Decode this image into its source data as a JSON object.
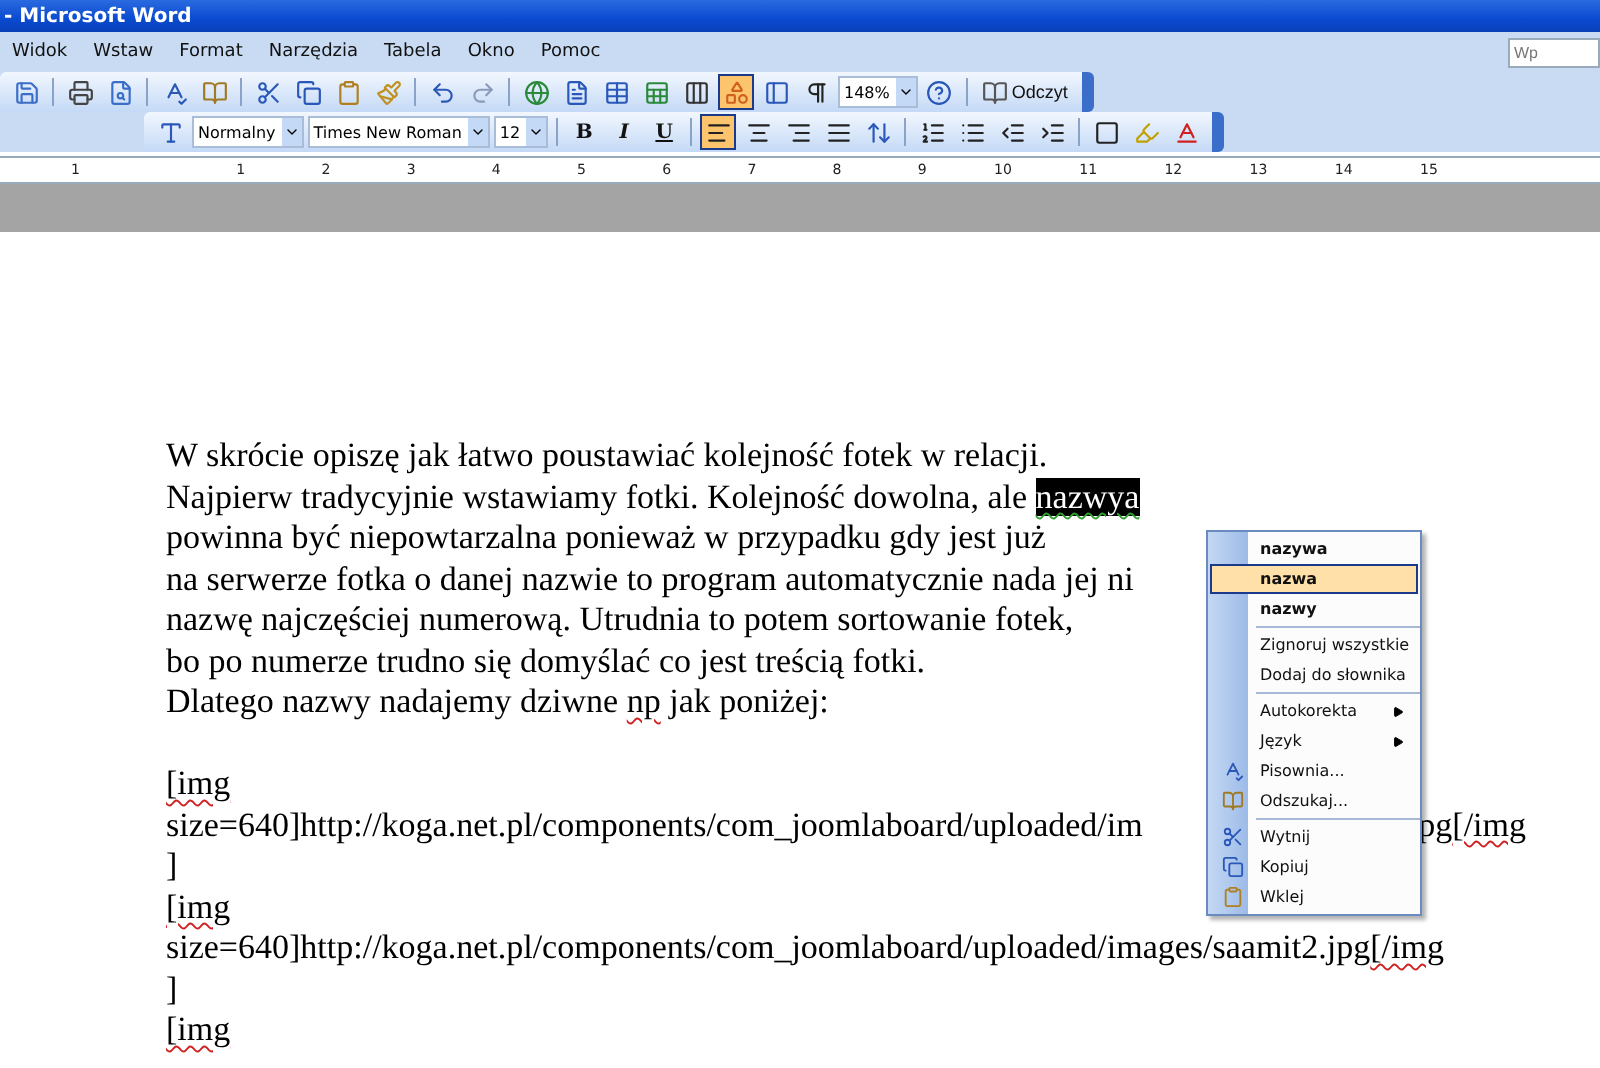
{
  "window": {
    "title": "- Microsoft Word"
  },
  "menu_bar": {
    "items": [
      {
        "label": "Widok"
      },
      {
        "label": "Wstaw"
      },
      {
        "label": "Format"
      },
      {
        "label": "Narzędzia"
      },
      {
        "label": "Tabela"
      },
      {
        "label": "Okno"
      },
      {
        "label": "Pomoc"
      }
    ],
    "help_search": {
      "placeholder": "Wp"
    }
  },
  "standard_toolbar": {
    "items": [
      {
        "kind": "icon",
        "on": false
      },
      {
        "kind": "sep"
      },
      {
        "kind": "icon",
        "on": false
      },
      {
        "kind": "icon",
        "on": false
      },
      {
        "kind": "sep"
      },
      {
        "kind": "icon",
        "on": false
      },
      {
        "kind": "icon",
        "on": false
      },
      {
        "kind": "sep"
      },
      {
        "kind": "icon",
        "on": false
      },
      {
        "kind": "icon",
        "on": false
      },
      {
        "kind": "icon",
        "on": false
      },
      {
        "kind": "icon",
        "on": false
      },
      {
        "kind": "sep"
      },
      {
        "kind": "icon",
        "on": false
      },
      {
        "kind": "icon",
        "on": false
      },
      {
        "kind": "sep"
      },
      {
        "kind": "icon",
        "on": false
      },
      {
        "kind": "icon",
        "on": false
      },
      {
        "kind": "icon",
        "on": false
      },
      {
        "kind": "icon",
        "on": false
      },
      {
        "kind": "icon",
        "on": false
      },
      {
        "kind": "icon",
        "on": true
      },
      {
        "kind": "icon",
        "on": false
      },
      {
        "kind": "icon",
        "on": false
      },
      {
        "kind": "combo",
        "value": "148%"
      },
      {
        "kind": "icon",
        "on": false
      },
      {
        "kind": "sep"
      },
      {
        "kind": "button",
        "label": "Odczyt"
      }
    ]
  },
  "formatting_toolbar": {
    "items": [
      {
        "kind": "icon",
        "on": false
      },
      {
        "kind": "combo",
        "value": "Normalny"
      },
      {
        "kind": "combo",
        "value": "Times New Roman"
      },
      {
        "kind": "combo",
        "value": "12"
      },
      {
        "kind": "sep"
      },
      {
        "kind": "text",
        "label": "B",
        "on": false
      },
      {
        "kind": "text",
        "label": "I",
        "on": false
      },
      {
        "kind": "text",
        "label": "U",
        "on": false
      },
      {
        "kind": "sep"
      },
      {
        "kind": "icon",
        "on": true
      },
      {
        "kind": "icon",
        "on": false
      },
      {
        "kind": "icon",
        "on": false
      },
      {
        "kind": "icon",
        "on": false
      },
      {
        "kind": "icon",
        "on": false
      },
      {
        "kind": "sep"
      },
      {
        "kind": "icon",
        "on": false
      },
      {
        "kind": "icon",
        "on": false
      },
      {
        "kind": "icon",
        "on": false
      },
      {
        "kind": "icon",
        "on": false
      },
      {
        "kind": "sep"
      },
      {
        "kind": "icon",
        "on": false
      },
      {
        "kind": "icon",
        "on": false
      },
      {
        "kind": "icon",
        "on": false
      }
    ]
  },
  "ruler": {
    "labels": [
      "1",
      "1",
      "2",
      "3",
      "4",
      "5",
      "6",
      "7",
      "8",
      "9",
      "10",
      "11",
      "12",
      "13",
      "14",
      "15"
    ]
  },
  "document": {
    "lines": [
      {
        "kind": "text",
        "parts": [
          {
            "text": "W skrócie opiszę jak łatwo poustawiać kolejność fotek w relacji.",
            "kind": "plain"
          }
        ]
      },
      {
        "kind": "text",
        "parts": [
          {
            "text": "Najpierw tradycyjnie wstawiamy fotki. Kolejność dowolna, ale ",
            "kind": "plain"
          },
          {
            "text": "nazwya",
            "kind": "selected"
          }
        ]
      },
      {
        "kind": "text",
        "parts": [
          {
            "text": "powinna być niepowtarzalna ponieważ w przypadku gdy jest już",
            "kind": "plain"
          }
        ]
      },
      {
        "kind": "text",
        "parts": [
          {
            "text": "na serwerze fotka o danej nazwie to program automatycznie nada jej ni",
            "kind": "plain"
          }
        ]
      },
      {
        "kind": "text",
        "parts": [
          {
            "text": "nazwę najczęściej numerową. Utrudnia to potem sortowanie fotek,",
            "kind": "plain"
          }
        ]
      },
      {
        "kind": "text",
        "parts": [
          {
            "text": "bo po numerze trudno się domyślać co jest treścią fotki.",
            "kind": "plain"
          }
        ]
      },
      {
        "kind": "text",
        "parts": [
          {
            "text": "Dlatego nazwy nadajemy dziwne ",
            "kind": "plain"
          },
          {
            "text": "np",
            "kind": "misspelled"
          },
          {
            "text": " jak poniżej:",
            "kind": "plain"
          }
        ]
      },
      {
        "kind": "blank"
      },
      {
        "kind": "text",
        "parts": [
          {
            "text": "[img",
            "kind": "misspelled"
          }
        ]
      },
      {
        "kind": "text",
        "parts": [
          {
            "text": "size=640]http://koga.net.pl/components/com_joomlaboard/uploaded/im",
            "kind": "plain"
          }
        ],
        "right": [
          {
            "text": "pg",
            "kind": "plain"
          },
          {
            "text": "[/img",
            "kind": "misspelled"
          }
        ]
      },
      {
        "kind": "text",
        "parts": [
          {
            "text": "]",
            "kind": "plain"
          }
        ]
      },
      {
        "kind": "text",
        "parts": [
          {
            "text": "[img",
            "kind": "misspelled"
          }
        ]
      },
      {
        "kind": "text",
        "parts": [
          {
            "text": "size=640]http://koga.net.pl/components/com_joomlaboard/uploaded/images/saamit2.jpg",
            "kind": "plain"
          },
          {
            "text": "[/img",
            "kind": "misspelled"
          }
        ]
      },
      {
        "kind": "text",
        "parts": [
          {
            "text": "]",
            "kind": "plain"
          }
        ]
      },
      {
        "kind": "text",
        "parts": [
          {
            "text": "[img",
            "kind": "misspelled"
          }
        ]
      }
    ]
  },
  "context_menu": {
    "groups": [
      [
        {
          "label": "nazywa",
          "kind": "suggestion",
          "selected": false
        },
        {
          "label": "nazwa",
          "kind": "suggestion",
          "selected": true
        },
        {
          "label": "nazwy",
          "kind": "suggestion",
          "selected": false
        }
      ],
      [
        {
          "label": "Zignoruj wszystkie",
          "kind": "command",
          "selected": false
        },
        {
          "label": "Dodaj do słownika",
          "kind": "command",
          "selected": false
        }
      ],
      [
        {
          "label": "Autokorekta",
          "kind": "submenu",
          "selected": false
        },
        {
          "label": "Język",
          "kind": "submenu",
          "selected": false
        },
        {
          "label": "Pisownia...",
          "kind": "icon_command",
          "selected": false
        },
        {
          "label": "Odszukaj...",
          "kind": "icon_command",
          "selected": false
        }
      ],
      [
        {
          "label": "Wytnij",
          "kind": "icon_command",
          "selected": false
        },
        {
          "label": "Kopiuj",
          "kind": "icon_command",
          "selected": false
        },
        {
          "label": "Wklej",
          "kind": "icon_command",
          "selected": false
        }
      ]
    ]
  }
}
